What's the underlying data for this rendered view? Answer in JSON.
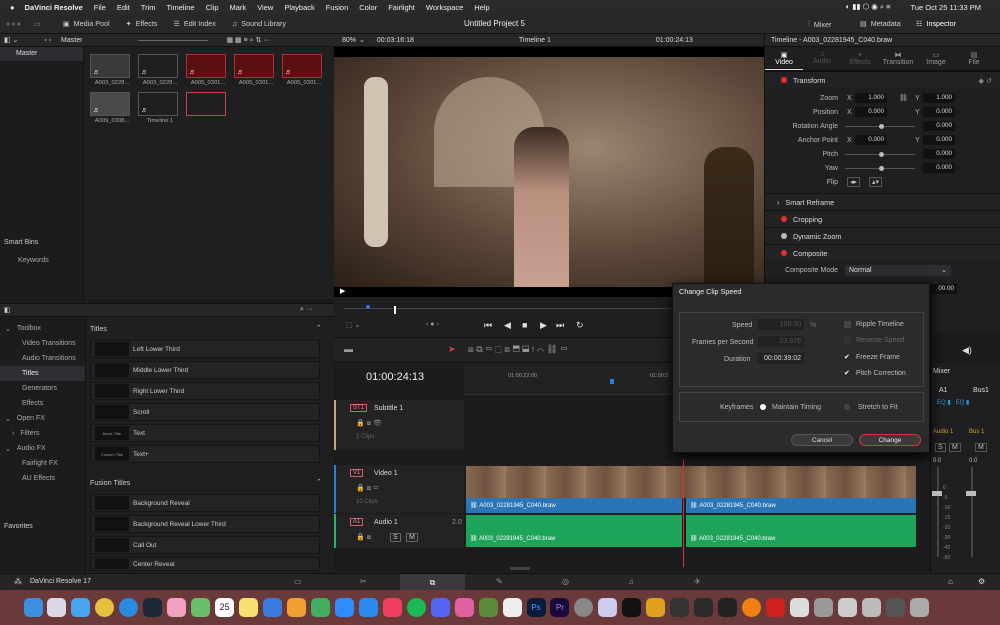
{
  "menubar": {
    "items": [
      "DaVinci Resolve",
      "File",
      "Edit",
      "Trim",
      "Timeline",
      "Clip",
      "Mark",
      "View",
      "Playback",
      "Fusion",
      "Color",
      "Fairlight",
      "Workspace",
      "Help"
    ],
    "datetime": "Tue Oct 25  11:33 PM"
  },
  "toolbar": {
    "media_pool": "Media Pool",
    "effects": "Effects",
    "edit_index": "Edit Index",
    "sound_library": "Sound Library",
    "project": "Untitled Project 5",
    "mixer": "Mixer",
    "metadata": "Metadata",
    "inspector": "Inspector"
  },
  "pool": {
    "bin": "Master",
    "master": "Master",
    "clips": [
      "A003_0228...",
      "A003_0228...",
      "A005_0301...",
      "A005_0301...",
      "A005_0301...",
      "A009_0308...",
      "Timeline 1"
    ],
    "smart_bins": "Smart Bins",
    "keywords": "Keywords"
  },
  "viewer": {
    "zoom": "80%",
    "timecode": "00:03:16:18",
    "timeline": "Timeline 1",
    "tc": "01:00:24:13"
  },
  "inspector": {
    "title": "Timeline - A003_02281945_C040.braw",
    "tabs": [
      "Video",
      "Audio",
      "Effects",
      "Transition",
      "Image",
      "File"
    ],
    "transform": "Transform",
    "zoom": "Zoom",
    "zx": "1.000",
    "zy": "1.000",
    "position": "Position",
    "px": "0.000",
    "py": "0.000",
    "rotation": "Rotation Angle",
    "rot": "0.000",
    "anchor": "Anchor Point",
    "ax": "0.000",
    "ay": "0.000",
    "pitch": "Pitch",
    "pitchv": "0.000",
    "yaw": "Yaw",
    "yawv": "0.000",
    "flip": "Flip",
    "smart_reframe": "Smart Reframe",
    "cropping": "Cropping",
    "dynamic_zoom": "Dynamic Zoom",
    "composite": "Composite",
    "comp_mode": "Composite Mode",
    "comp_val": "Normal",
    "opacity": "00.00",
    "x": "X",
    "y": "Y"
  },
  "effects": {
    "toolbox": "Toolbox",
    "video_transitions": "Video Transitions",
    "audio_transitions": "Audio Transitions",
    "titles": "Titles",
    "generators": "Generators",
    "effects": "Effects",
    "open_fx": "Open FX",
    "filters": "Filters",
    "audio_fx": "Audio FX",
    "fairlight_fx": "Fairlight FX",
    "au_effects": "AU Effects",
    "favorites": "Favorites",
    "titles_header": "Titles",
    "title_items": [
      "Left Lower Third",
      "Middle Lower Third",
      "Right Lower Third",
      "Scroll",
      "Text",
      "Text+"
    ],
    "thumbs": [
      "",
      "",
      "",
      "",
      "Basic Title",
      "Custom Title"
    ],
    "fusion_titles": "Fusion Titles",
    "fusion_items": [
      "Background Reveal",
      "Background Reveal Lower Third",
      "Call Out",
      "Center Reveal"
    ]
  },
  "timeline": {
    "tc": "01:00:24:13",
    "ruler1": "01:00:22:00",
    "ruler2": "01:00:2",
    "st1": "ST1",
    "subtitle": "Subtitle 1",
    "clips2": "2 Clips",
    "v1": "V1",
    "video": "Video 1",
    "clips10": "10 Clips",
    "a1": "A1",
    "audio": "Audio 1",
    "level": "2.0",
    "clip_name": "A003_02281945_C040.braw",
    "s": "S",
    "m": "M"
  },
  "mixer": {
    "title": "Mixer",
    "a1": "A1",
    "bus1": "Bus1",
    "audio1": "Audio 1",
    "bus1b": "Bus 1",
    "db": "0.0",
    "db2": "0.0",
    "scale": [
      "0",
      "-5",
      "-10",
      "-15",
      "-20",
      "-30",
      "-40",
      "-50"
    ]
  },
  "dialog": {
    "title": "Change Clip Speed",
    "speed": "Speed",
    "speed_val": "100.00",
    "pct": "%",
    "fps": "Frames per Second",
    "fps_val": "23.976",
    "duration": "Duration",
    "dur_val": "00:00:39:02",
    "ripple": "Ripple Timeline",
    "reverse": "Reverse Speed",
    "freeze": "Freeze Frame",
    "pitch": "Pitch Correction",
    "keyframes": "Keyframes",
    "maintain": "Maintain Timing",
    "stretch": "Stretch to Fit",
    "cancel": "Cancel",
    "change": "Change"
  },
  "footer": {
    "app": "DaVinci Resolve 17"
  },
  "dock": {
    "date": "25"
  }
}
